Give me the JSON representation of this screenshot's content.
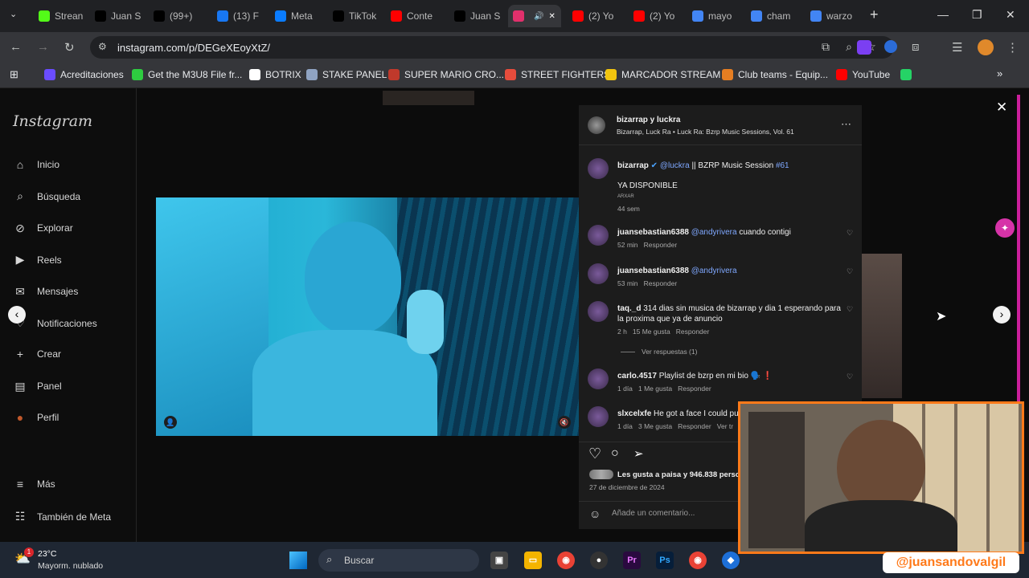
{
  "browser": {
    "tabs": [
      {
        "label": "Strean",
        "icon": "kick-icon",
        "color": "#53fc18"
      },
      {
        "label": "Juan S",
        "icon": "x-icon",
        "color": "#000000"
      },
      {
        "label": "(99+)",
        "icon": "tiktok-icon",
        "color": "#000000"
      },
      {
        "label": "(13) F",
        "icon": "facebook-icon",
        "color": "#1877f2"
      },
      {
        "label": "Meta",
        "icon": "meta-icon",
        "color": "#0a7cff"
      },
      {
        "label": "TikTok",
        "icon": "tiktok-icon",
        "color": "#000000"
      },
      {
        "label": "Conte",
        "icon": "youtube-icon",
        "color": "#ff0000"
      },
      {
        "label": "Juan S",
        "icon": "x-icon",
        "color": "#000000"
      },
      {
        "label": "",
        "icon": "instagram-icon",
        "color": "#e1306c"
      },
      {
        "label": "(2) Yo",
        "icon": "youtube-icon",
        "color": "#ff0000"
      },
      {
        "label": "(2) Yo",
        "icon": "youtube-icon",
        "color": "#ff0000"
      },
      {
        "label": "mayo",
        "icon": "google-icon",
        "color": "#4285f4"
      },
      {
        "label": "cham",
        "icon": "google-icon",
        "color": "#4285f4"
      },
      {
        "label": "warzo",
        "icon": "google-icon",
        "color": "#4285f4"
      }
    ],
    "url": "instagram.com/p/DEGeXEoyXtZ/",
    "bookmarks": [
      {
        "label": "Acreditaciones",
        "color": "#6a4cff"
      },
      {
        "label": "Get the M3U8 File fr...",
        "color": "#2ecc40"
      },
      {
        "label": "BOTRIX",
        "color": "#ffffff"
      },
      {
        "label": "STAKE PANEL",
        "color": "#8fa3c2"
      },
      {
        "label": "SUPER MARIO CRO...",
        "color": "#c0392b"
      },
      {
        "label": "STREET FIGHTERS",
        "color": "#e74c3c"
      },
      {
        "label": "MARCADOR STREAM",
        "color": "#f1c40f"
      },
      {
        "label": "Club teams - Equip...",
        "color": "#e67e22"
      },
      {
        "label": "YouTube",
        "color": "#ff0000"
      },
      {
        "label": "",
        "color": "#25d366"
      }
    ]
  },
  "instagram": {
    "logo": "Instagram",
    "nav": [
      {
        "label": "Inicio",
        "icon": "home-icon"
      },
      {
        "label": "Búsqueda",
        "icon": "search-icon"
      },
      {
        "label": "Explorar",
        "icon": "compass-icon"
      },
      {
        "label": "Reels",
        "icon": "reels-icon"
      },
      {
        "label": "Mensajes",
        "icon": "messenger-icon"
      },
      {
        "label": "Notificaciones",
        "icon": "heart-icon"
      },
      {
        "label": "Crear",
        "icon": "plus-icon"
      },
      {
        "label": "Panel",
        "icon": "chart-icon"
      },
      {
        "label": "Perfil",
        "icon": "avatar-icon"
      }
    ],
    "more": "Más",
    "also_meta": "También de Meta",
    "post": {
      "author": "bizarrap y luckra",
      "audio": "Bizarrap, Luck Ra • Luck Ra: Bzrp Music Sessions, Vol. 61",
      "caption_user": "bizarrap",
      "caption_mention": "@luckra",
      "caption_text": " || BZRP Music Session ",
      "caption_tag": "#61",
      "caption_line2": "YA DISPONIBLE",
      "caption_line3": "ARXAR",
      "caption_age": "44 sem",
      "comments": [
        {
          "user": "juansebastian6388",
          "mention": "@andyrivera",
          "text": " cuando contigi",
          "meta": "52 min   Responder"
        },
        {
          "user": "juansebastian6388",
          "mention": "@andyrivera",
          "text": "",
          "meta": "53 min   Responder"
        },
        {
          "user": "taq._d",
          "mention": "",
          "text": " 314 dias sin musica de bizarrap y dia 1 esperando para la proxima que ya de anuncio",
          "meta": "2 h   15 Me gusta   Responder"
        },
        {
          "user": "carlo.4517",
          "mention": "",
          "text": " Playlist de bzrp en mi bio 🗣️ ❗",
          "meta": "1 día   1 Me gusta   Responder"
        },
        {
          "user": "slxcelxfe",
          "mention": "",
          "text": " He got a face I could pun",
          "meta": "1 día   3 Me gusta   Responder   Ver tr"
        }
      ],
      "view_replies": "Ver respuestas (1)",
      "likes": "Les gusta a paisa y 946.838 perso",
      "date": "27 de diciembre de 2024",
      "comment_placeholder": "Añade un comentario..."
    }
  },
  "taskbar": {
    "weather_temp": "23°C",
    "weather_desc": "Mayorm. nublado",
    "weather_badge": "1",
    "search_placeholder": "Buscar"
  },
  "overlay": {
    "handle": "@juansandovalgil"
  }
}
